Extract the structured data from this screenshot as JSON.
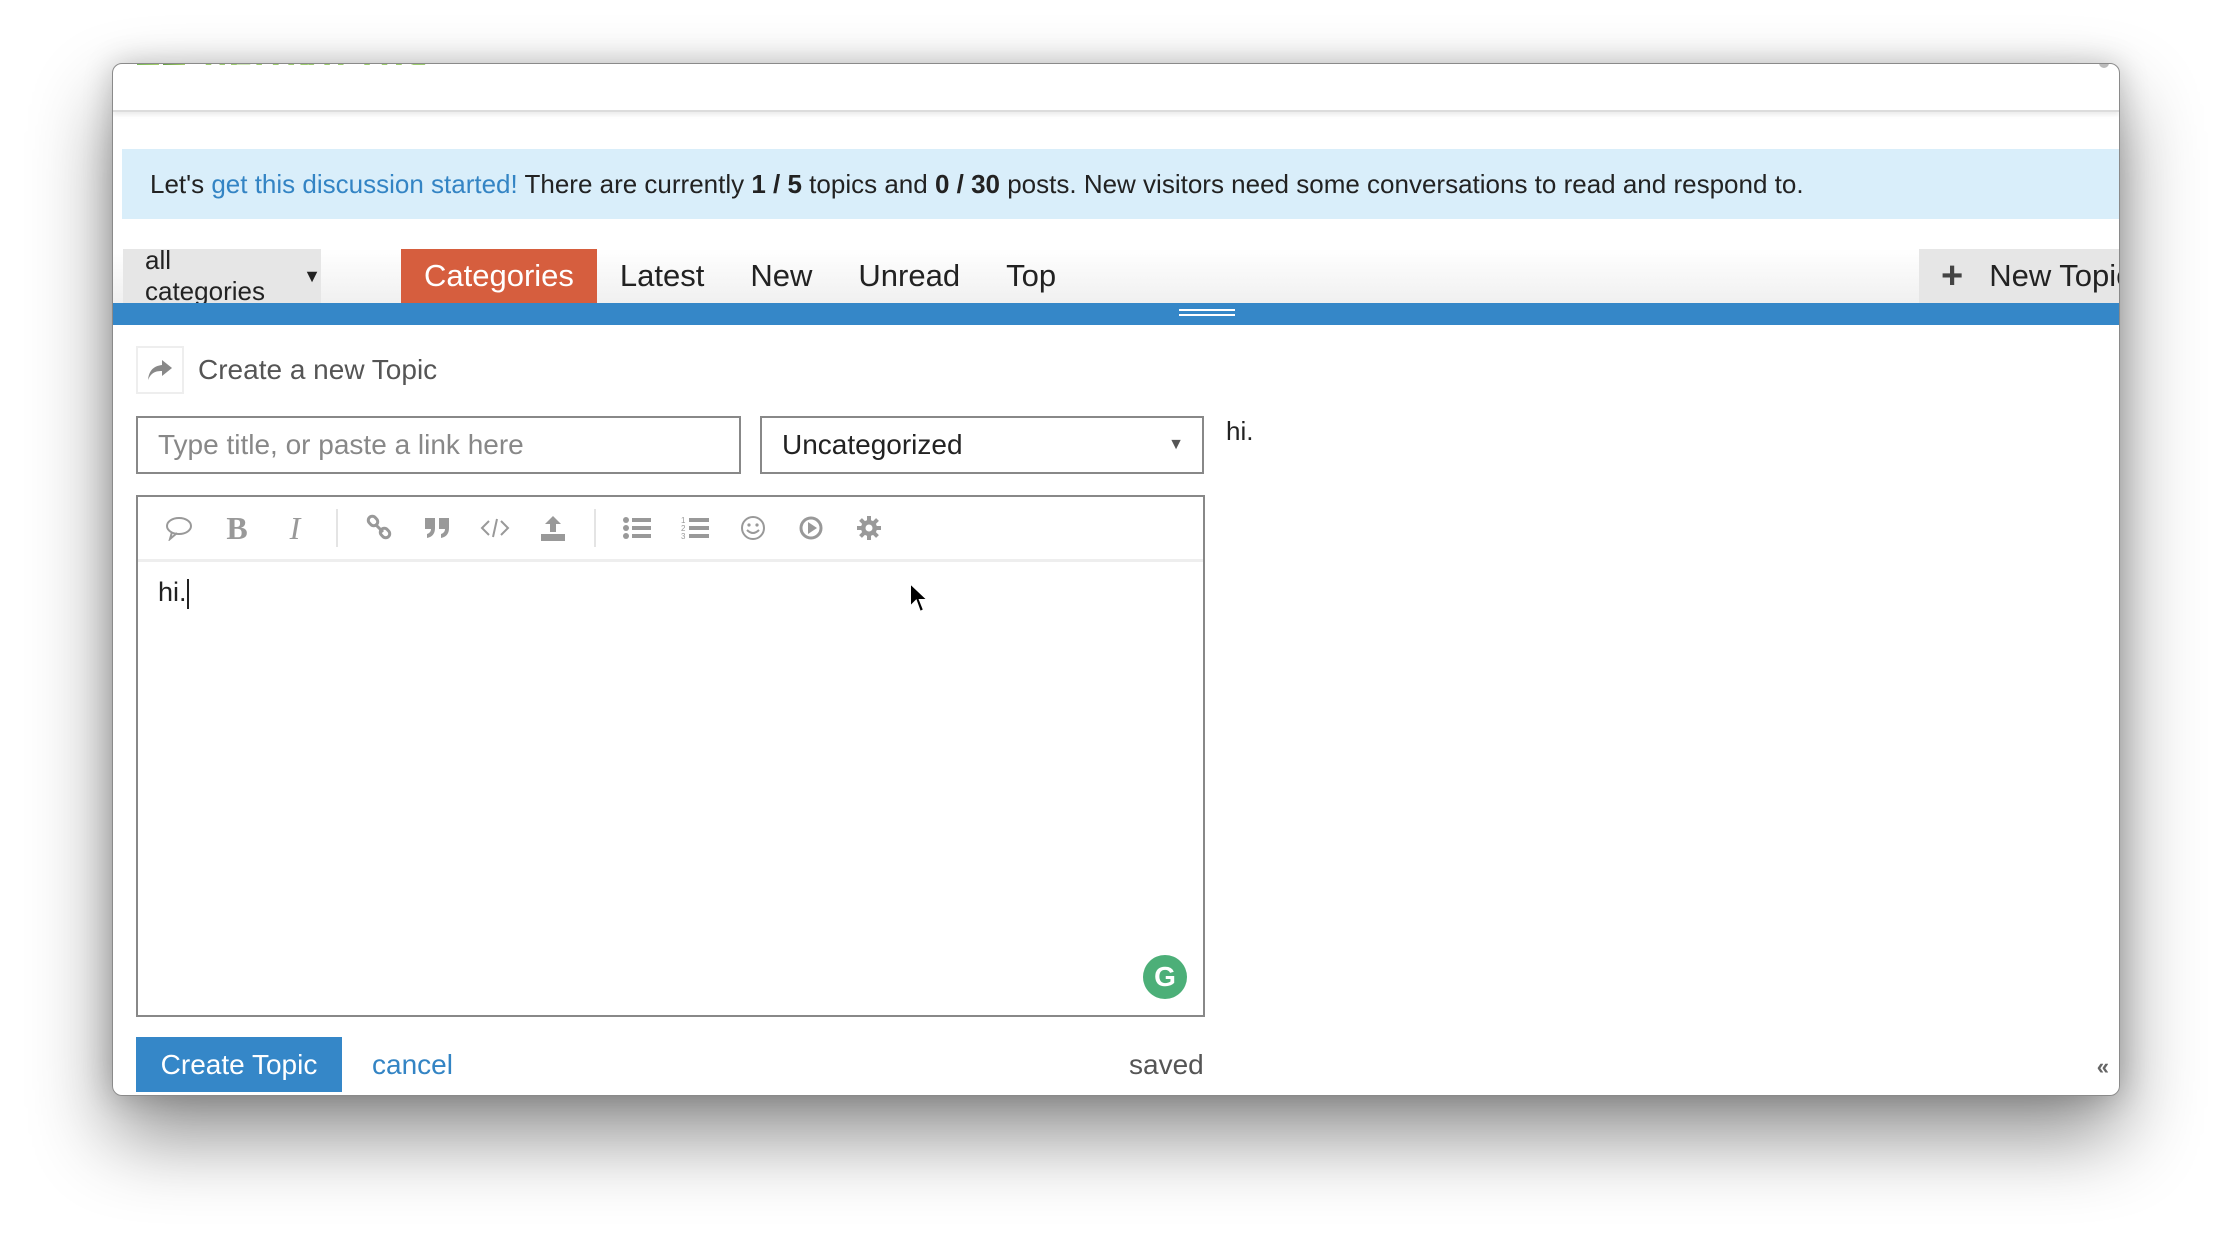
{
  "header": {
    "logo_text": "heroku rbs"
  },
  "banner": {
    "prefix": "Let's ",
    "link": "get this discussion started!",
    "text1": " There are currently ",
    "topics": "1 / 5",
    "text2": " topics and ",
    "posts": "0 / 30",
    "text3": " posts. New visitors need some conversations to read and respond to."
  },
  "nav": {
    "category_dropdown": "all categories",
    "items": [
      {
        "label": "Categories",
        "active": true
      },
      {
        "label": "Latest",
        "active": false
      },
      {
        "label": "New",
        "active": false
      },
      {
        "label": "Unread",
        "active": false
      },
      {
        "label": "Top",
        "active": false
      }
    ],
    "new_topic_button": "New Topic"
  },
  "composer": {
    "action_label": "Create a new Topic",
    "title_placeholder": "Type title, or paste a link here",
    "title_value": "",
    "category": "Uncategorized",
    "body_text": "hi.",
    "preview_text": "hi.",
    "toolbar": [
      "quote",
      "bold",
      "italic",
      "link",
      "blockquote",
      "code",
      "upload",
      "bullet-list",
      "numbered-list",
      "emoji",
      "video",
      "options"
    ],
    "submit_label": "Create Topic",
    "cancel_label": "cancel",
    "status": "saved",
    "collapse_label": "«"
  },
  "colors": {
    "accent_blue": "#3587c8",
    "active_tab": "#d65e3e",
    "banner_bg": "#d9eefa",
    "link": "#3384c4"
  }
}
